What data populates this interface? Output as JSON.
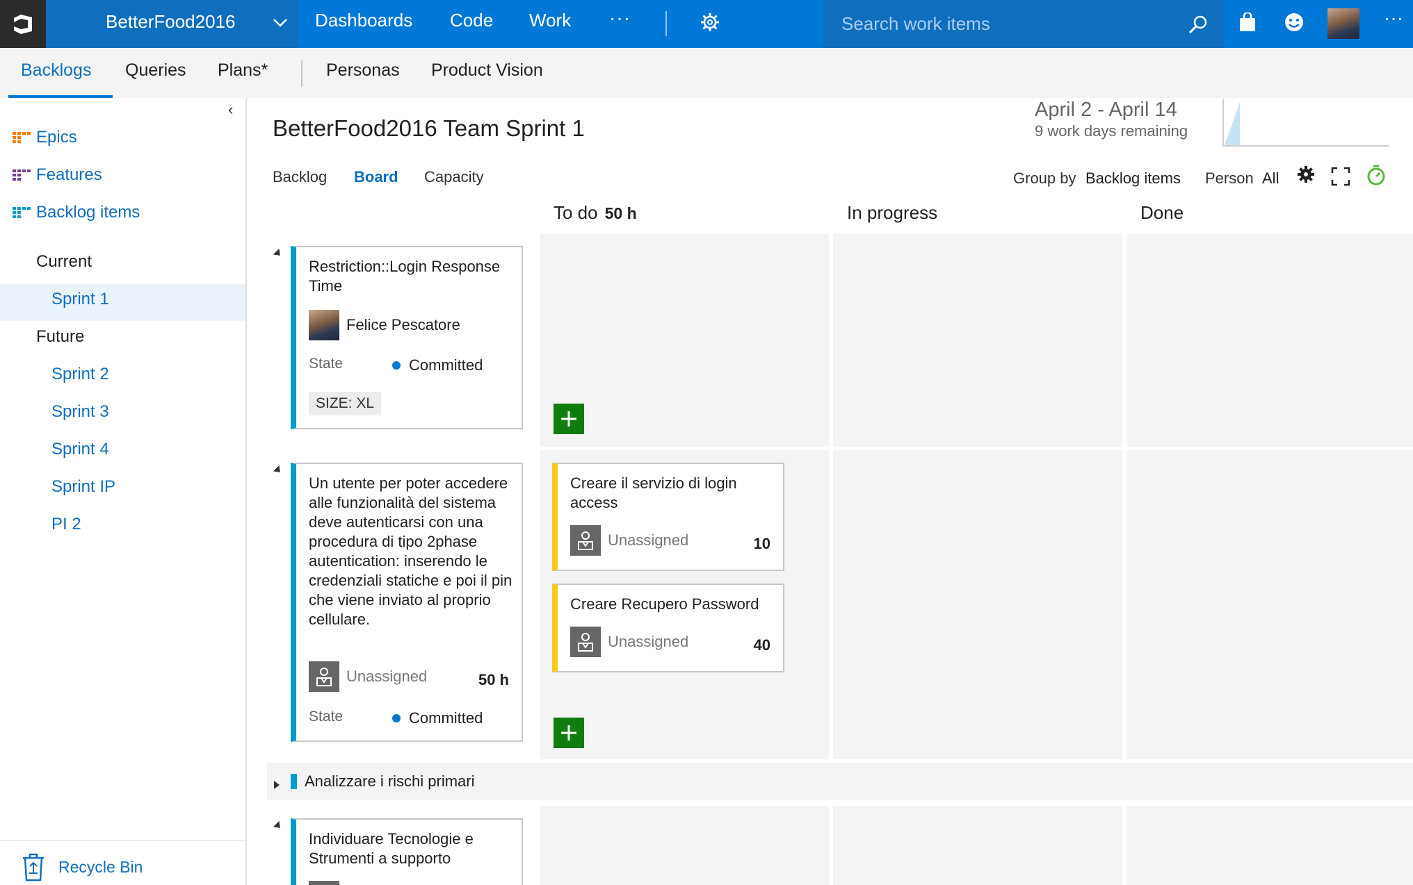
{
  "header": {
    "project_name": "BetterFood2016",
    "nav": [
      "Dashboards",
      "Code",
      "Work"
    ],
    "nav_more": "···",
    "search_placeholder": "Search work items",
    "more": "···"
  },
  "subnav": {
    "tabs": [
      "Backlogs",
      "Queries",
      "Plans*",
      "Personas",
      "Product Vision"
    ]
  },
  "sidebar": {
    "collapse": "‹",
    "backlog_levels": [
      {
        "label": "Epics",
        "color": "#ff7b00"
      },
      {
        "label": "Features",
        "color": "#773b93"
      },
      {
        "label": "Backlog items",
        "color": "#009ccc"
      }
    ],
    "current_label": "Current",
    "current_items": [
      "Sprint 1"
    ],
    "future_label": "Future",
    "future_items": [
      "Sprint 2",
      "Sprint 3",
      "Sprint 4",
      "Sprint IP",
      "PI 2"
    ],
    "recycle_bin": "Recycle Bin"
  },
  "page": {
    "title": "BetterFood2016 Team Sprint 1",
    "sprint_dates": "April 2 - April 14",
    "work_days_remaining": "9 work days remaining",
    "pivots": [
      "Backlog",
      "Board",
      "Capacity"
    ],
    "group_by_label": "Group by",
    "group_by_value": "Backlog items",
    "person_label": "Person",
    "person_value": "All"
  },
  "board": {
    "columns": [
      {
        "name": "To do",
        "hours": "50 h"
      },
      {
        "name": "In progress"
      },
      {
        "name": "Done"
      }
    ],
    "rows": [
      {
        "title": "Restriction::Login Response Time",
        "assignee": "Felice Pescatore",
        "state_label": "State",
        "state": "Committed",
        "tag": "SIZE: XL"
      },
      {
        "title": "Un utente per poter accedere alle funzionalità del sistema deve autenticarsi con una procedura di tipo 2phase autentication: inserendo le credenziali statiche e poi il pin che viene inviato al proprio cellulare.",
        "assignee": "Unassigned",
        "remaining": "50 h",
        "state_label": "State",
        "state": "Committed",
        "tasks": [
          {
            "title": "Creare il servizio di login access",
            "assignee": "Unassigned",
            "remaining": "10"
          },
          {
            "title": "Creare Recupero Password",
            "assignee": "Unassigned",
            "remaining": "40"
          }
        ]
      },
      {
        "title": "Analizzare i rischi primari",
        "collapsed": true
      },
      {
        "title": "Individuare Tecnologie e Strumenti a supporto"
      }
    ]
  }
}
